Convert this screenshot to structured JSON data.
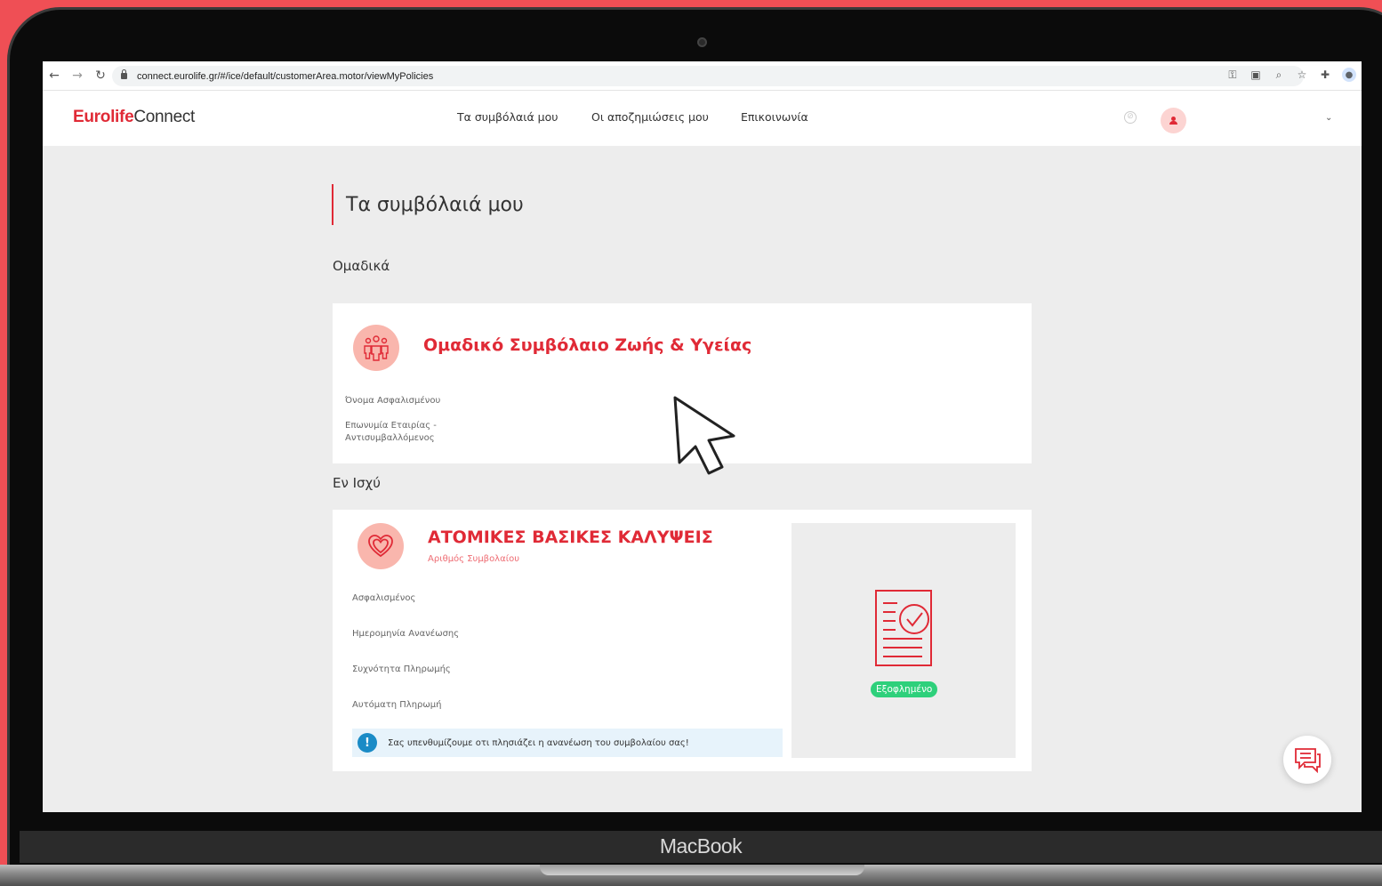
{
  "browser": {
    "url": "connect.eurolife.gr/#/ice/default/customerArea.motor/viewMyPolicies"
  },
  "header": {
    "logo_bold": "Eurolife",
    "logo_light": "Connect",
    "nav": [
      {
        "label": "Τα συμβόλαιά μου"
      },
      {
        "label": "Οι αποζημιώσεις μου"
      },
      {
        "label": "Επικοινωνία"
      }
    ]
  },
  "page": {
    "title": "Τα συμβόλαιά μου",
    "sections": [
      {
        "label": "Ομαδικά"
      },
      {
        "label": "Εν Ισχύ"
      }
    ]
  },
  "group_card": {
    "title": "Ομαδικό Συμβόλαιο Ζωής & Υγείας",
    "insured_name_label": "Όνομα Ασφαλισμένου",
    "company_label_line1": "Επωνυμία Εταιρίας -",
    "company_label_line2": "Αντισυμβαλλόμενος",
    "icon": "group-people-icon"
  },
  "policy_card": {
    "title": "ΑΤΟΜΙΚΕΣ ΒΑΣΙΚΕΣ ΚΑΛΥΨΕΙΣ",
    "policy_number_label": "Αριθμός Συμβολαίου",
    "fields": [
      {
        "label": "Ασφαλισμένος"
      },
      {
        "label": "Ημερομηνία Ανανέωσης"
      },
      {
        "label": "Συχνότητα Πληρωμής"
      },
      {
        "label": "Αυτόματη Πληρωμή"
      }
    ],
    "notice": "Σας υπενθυμίζουμε οτι πλησιάζει η ανανέωση του συμβολαίου σας!",
    "status_badge": "Εξοφλημένο",
    "icon": "heart-icon"
  },
  "device": {
    "label": "MacBook"
  },
  "colors": {
    "brand_red": "#e02a36",
    "background": "#ef4f55",
    "paid_green": "#2ed07b",
    "info_blue": "#1a8bc6"
  }
}
